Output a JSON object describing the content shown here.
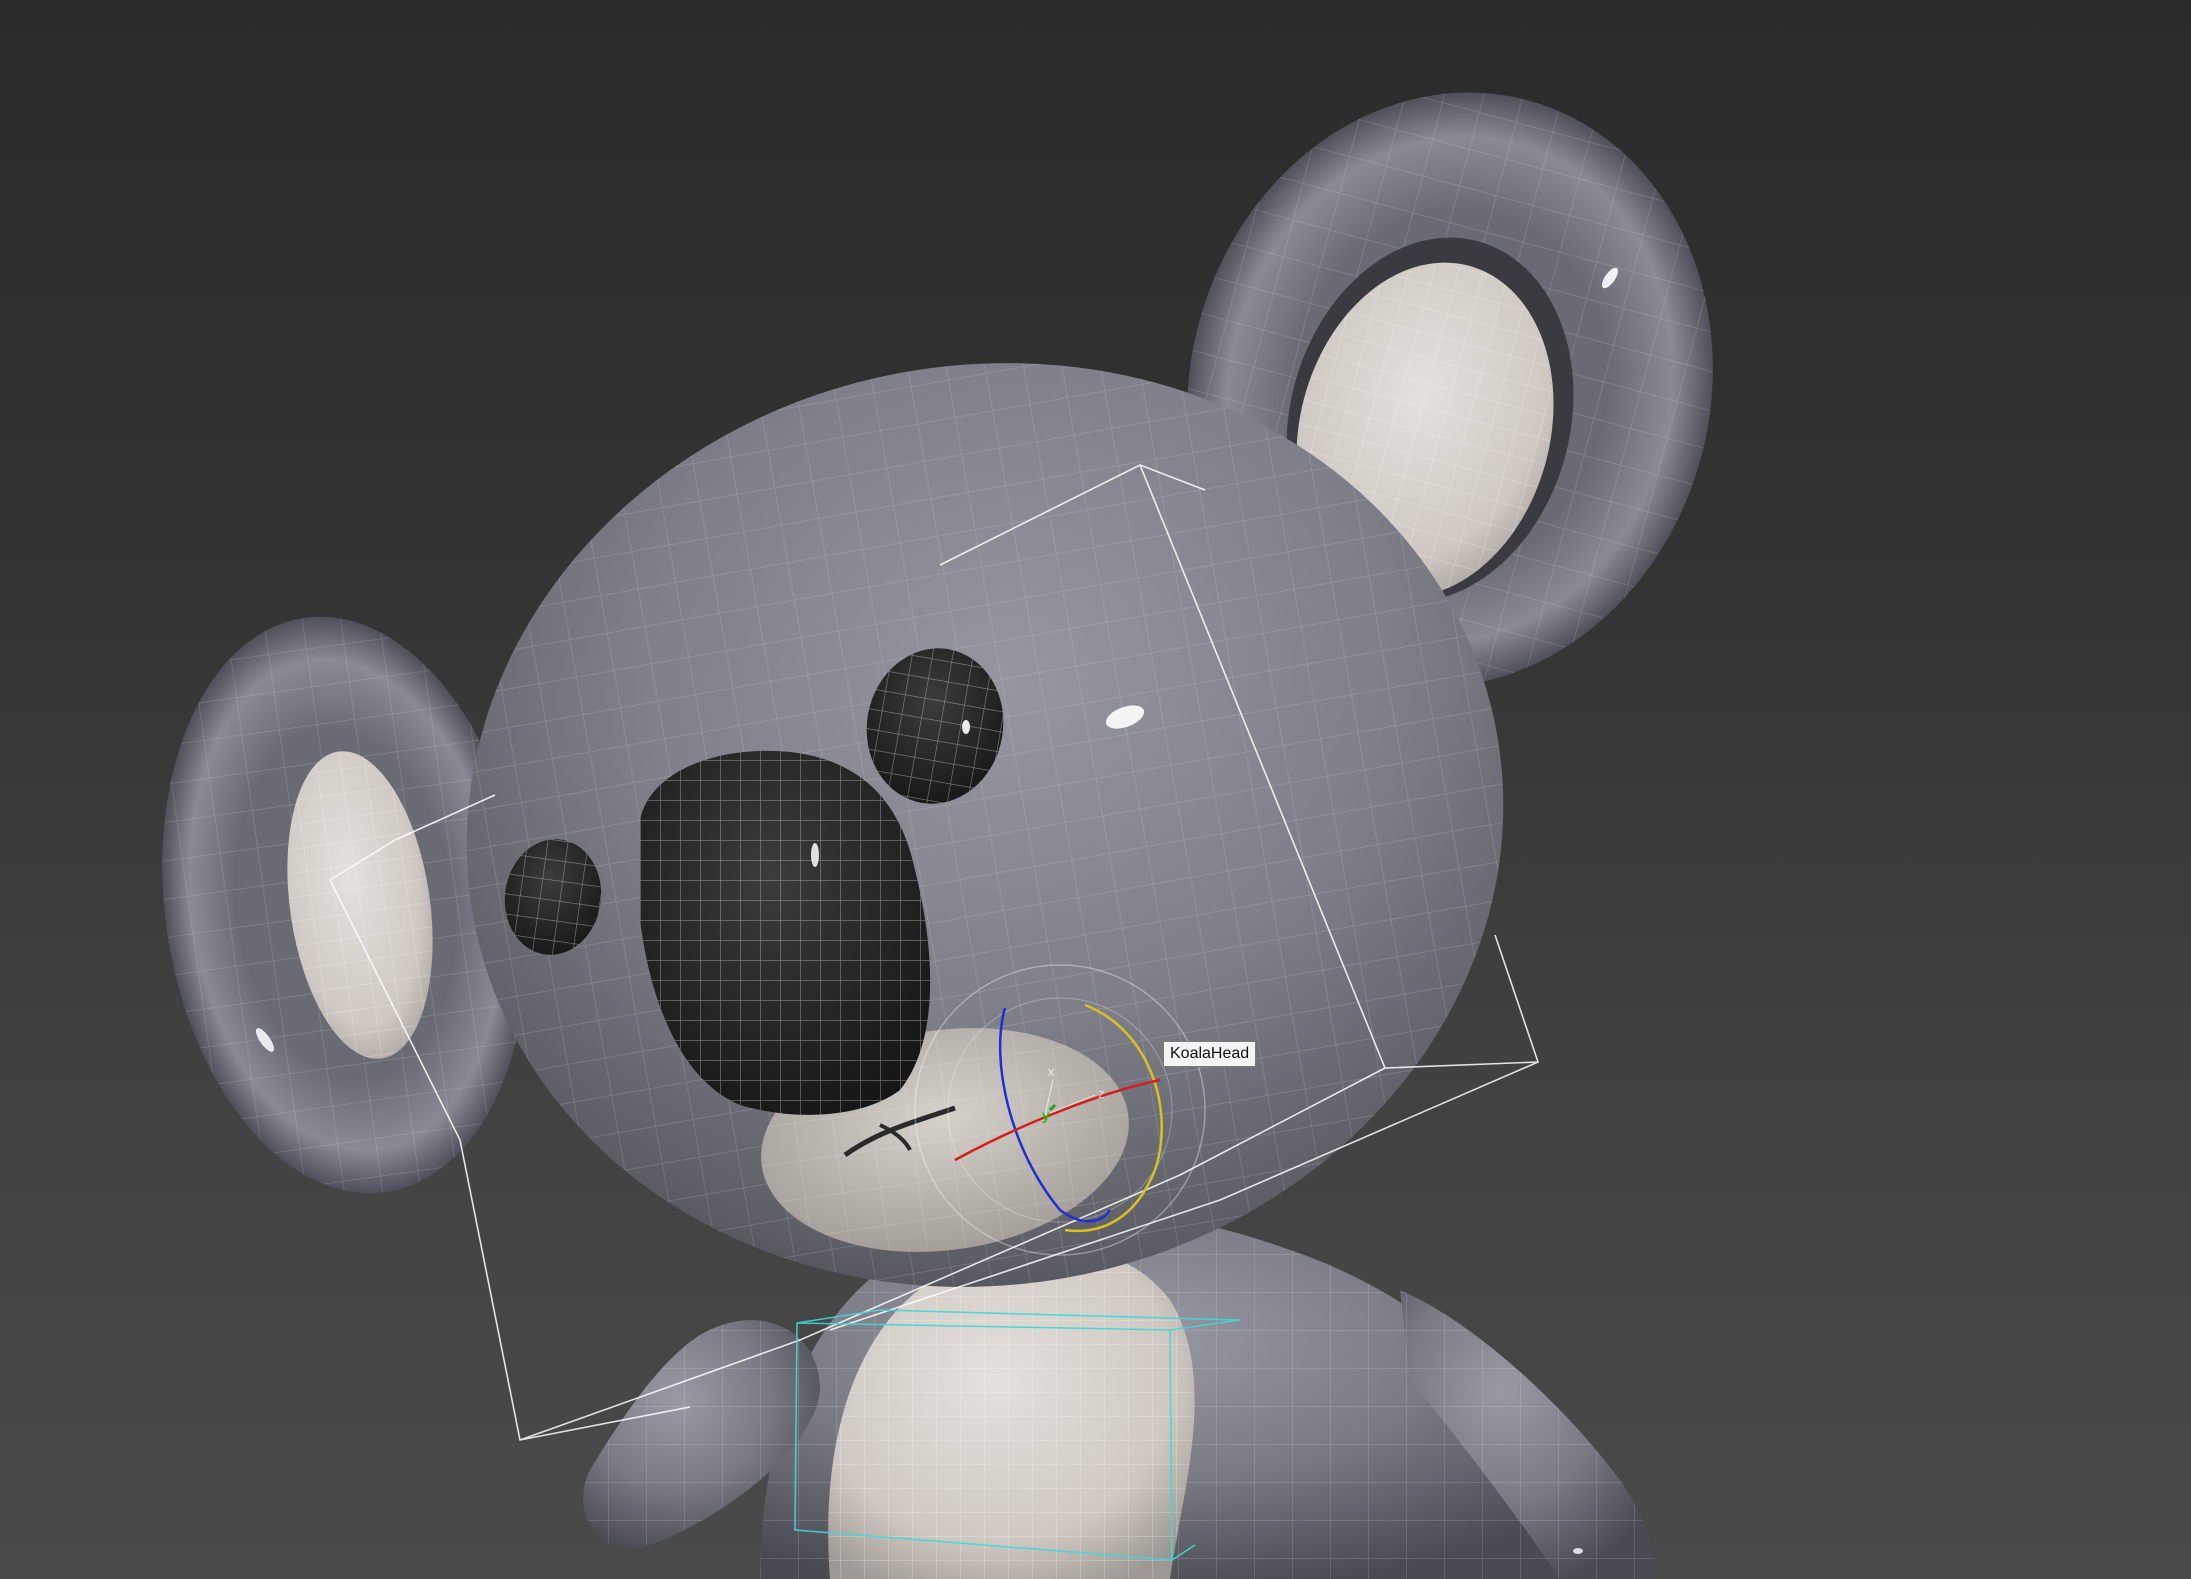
{
  "viewport": {
    "object_label": "KoalaHead",
    "gizmo": {
      "axis_x_label": "x",
      "axis_y_label": "y",
      "axis_z_label": "z",
      "axis_x_color": "#d02020",
      "axis_y_color": "#20a020",
      "axis_z_color": "#2030d0",
      "ring_color": "#d8c020"
    },
    "selection_box_color": "#ffffff",
    "secondary_box_color": "#40d8d8",
    "background_colors": [
      "#2b2b2b",
      "#4a4a4a"
    ],
    "model_colors": {
      "fur": "#7c7c86",
      "inner": "#d6d0cc",
      "dark": "#262626"
    }
  }
}
